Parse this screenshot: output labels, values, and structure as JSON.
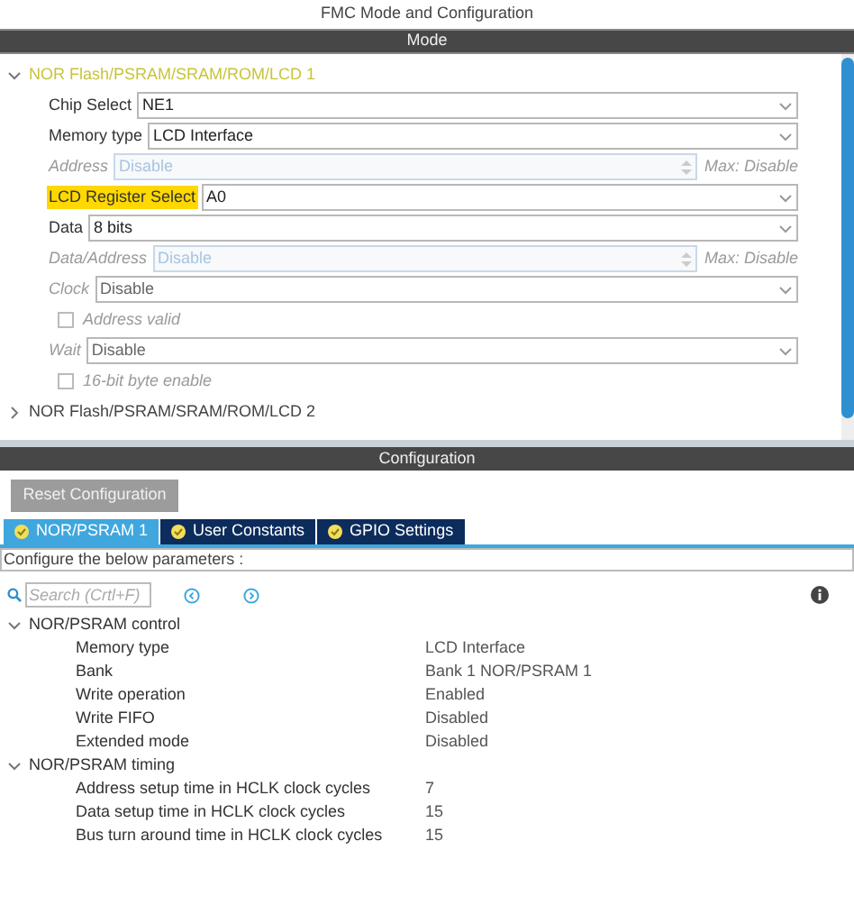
{
  "window": {
    "title": "FMC Mode and Configuration"
  },
  "mode": {
    "header": "Mode",
    "groups": [
      {
        "label": "NOR Flash/PSRAM/SRAM/ROM/LCD 1",
        "expanded": true,
        "fields": [
          {
            "kind": "select",
            "label": "Chip Select",
            "value": "NE1",
            "disabled": false,
            "highlighted": false
          },
          {
            "kind": "select",
            "label": "Memory type",
            "value": "LCD Interface",
            "disabled": false,
            "highlighted": false
          },
          {
            "kind": "spin",
            "label": "Address",
            "value": "Disable",
            "max": "Max: Disable",
            "disabled": true,
            "highlighted": false
          },
          {
            "kind": "select",
            "label": "LCD Register Select",
            "value": "A0",
            "disabled": false,
            "highlighted": true
          },
          {
            "kind": "select",
            "label": "Data",
            "value": "8 bits",
            "disabled": false,
            "highlighted": false
          },
          {
            "kind": "spin",
            "label": "Data/Address",
            "value": "Disable",
            "max": "Max: Disable",
            "disabled": true,
            "highlighted": false
          },
          {
            "kind": "select",
            "label": "Clock",
            "value": "Disable",
            "disabled": true,
            "highlighted": false
          },
          {
            "kind": "checkbox",
            "label": "Address valid",
            "checked": false,
            "disabled": true,
            "highlighted": false
          },
          {
            "kind": "select",
            "label": "Wait",
            "value": "Disable",
            "disabled": true,
            "highlighted": false
          },
          {
            "kind": "checkbox",
            "label": "16-bit byte enable",
            "checked": false,
            "disabled": true,
            "highlighted": false
          }
        ]
      },
      {
        "label": "NOR Flash/PSRAM/SRAM/ROM/LCD 2",
        "expanded": false
      }
    ]
  },
  "configuration": {
    "header": "Configuration",
    "reset_button": "Reset Configuration",
    "tabs": [
      {
        "label": "NOR/PSRAM 1",
        "selected": true
      },
      {
        "label": "User Constants",
        "selected": false
      },
      {
        "label": "GPIO Settings",
        "selected": false
      }
    ],
    "parameters_heading": "Configure the below parameters :",
    "search": {
      "placeholder": "Search (Crtl+F)"
    },
    "groups": [
      {
        "label": "NOR/PSRAM control",
        "expanded": true,
        "params": [
          {
            "name": "Memory type",
            "value": "LCD Interface"
          },
          {
            "name": "Bank",
            "value": "Bank 1 NOR/PSRAM 1"
          },
          {
            "name": "Write operation",
            "value": "Enabled"
          },
          {
            "name": "Write FIFO",
            "value": "Disabled"
          },
          {
            "name": "Extended mode",
            "value": "Disabled"
          }
        ]
      },
      {
        "label": "NOR/PSRAM timing",
        "expanded": true,
        "params": [
          {
            "name": "Address setup time in HCLK clock cycles",
            "value": "7"
          },
          {
            "name": "Data setup time in HCLK clock cycles",
            "value": "15"
          },
          {
            "name": "Bus turn around time in HCLK clock cycles",
            "value": "15"
          }
        ]
      }
    ]
  }
}
